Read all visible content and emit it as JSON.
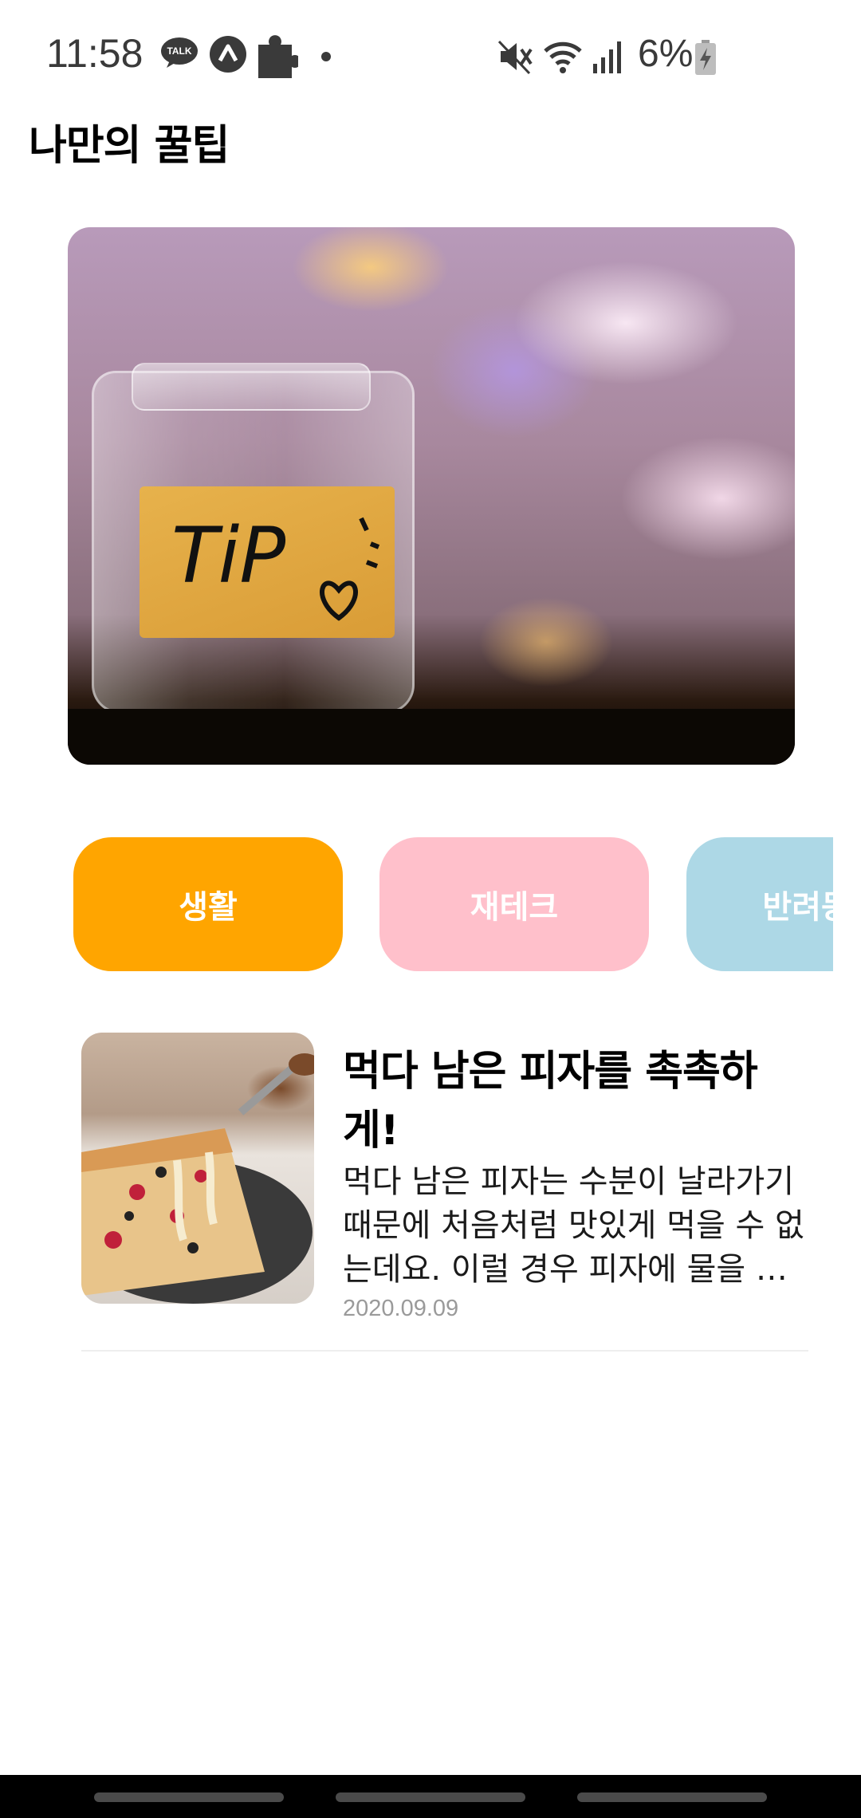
{
  "status_bar": {
    "time": "11:58",
    "talk_badge": "TALK",
    "battery": "6%",
    "icons": [
      "kakaotalk-icon",
      "arrow-up-icon",
      "puzzle-icon",
      "dot-icon",
      "mute-icon",
      "wifi-icon",
      "signal-icon",
      "battery-charging-icon"
    ]
  },
  "header": {
    "title": "나만의 꿀팁"
  },
  "hero": {
    "label_text": "TiP"
  },
  "categories": [
    {
      "label": "생활",
      "color": "#FFA500"
    },
    {
      "label": "재테크",
      "color": "#FFC0CB"
    },
    {
      "label": "반려동물",
      "color": "#ADD8E6"
    }
  ],
  "tips": [
    {
      "title": "먹다 남은 피자를 촉촉하게!",
      "description": "먹다 남은 피자는 수분이 날라가기 때문에 처음처럼 맛있게 먹을 수 없는데요. 이럴 경우 피자에 물을 살짝 뿌려 데우면 촉촉해집니다.",
      "date": "2020.09.09"
    }
  ]
}
